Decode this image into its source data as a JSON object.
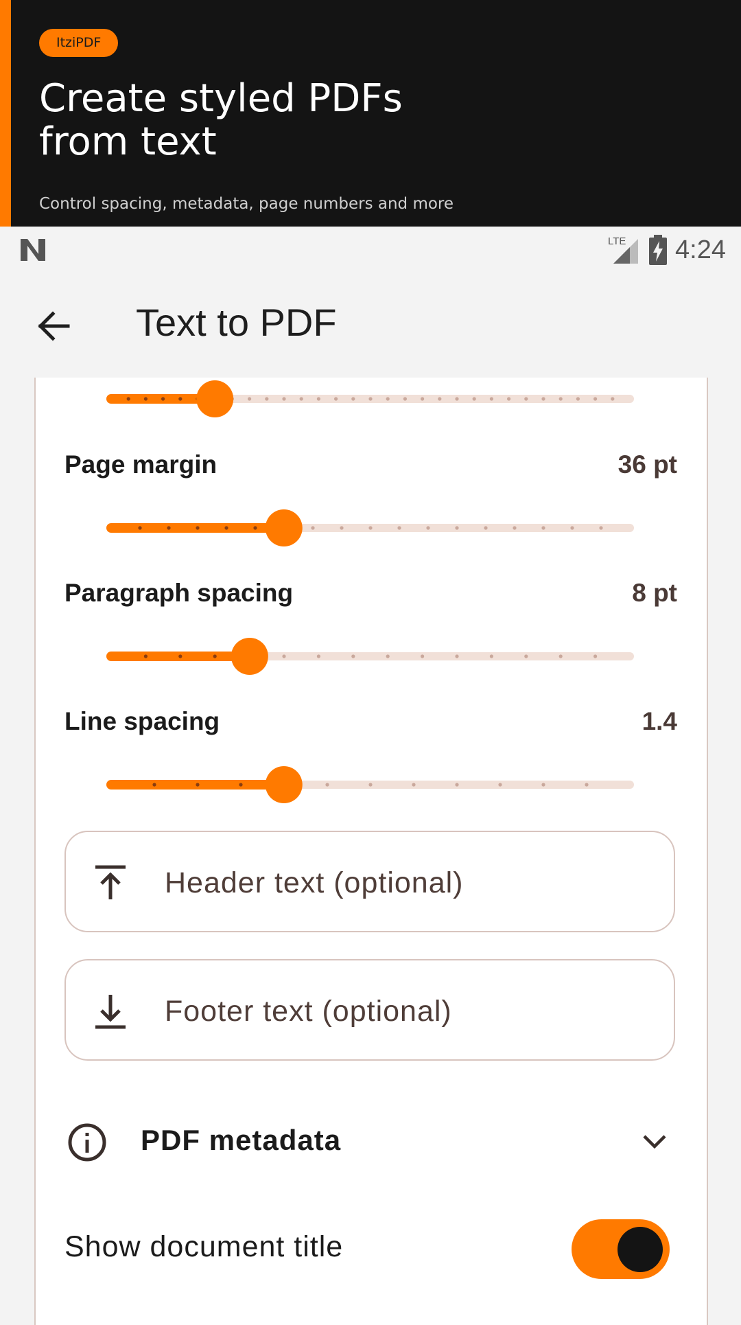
{
  "banner": {
    "badge": "ItziPDF",
    "title_line1": "Create styled PDFs",
    "title_line2": "from text",
    "subtitle": "Control spacing, metadata, page numbers and more"
  },
  "status": {
    "time": "4:24",
    "network": "LTE"
  },
  "appbar": {
    "title": "Text to PDF"
  },
  "settings": {
    "top_slider": {
      "fraction": 0.2,
      "ticks": 30
    },
    "page_margin": {
      "label": "Page margin",
      "value": "36 pt",
      "fraction": 0.333,
      "ticks": 18
    },
    "paragraph_spacing": {
      "label": "Paragraph spacing",
      "value": "8 pt",
      "fraction": 0.267,
      "ticks": 15
    },
    "line_spacing": {
      "label": "Line spacing",
      "value": "1.4",
      "fraction": 0.333,
      "ticks": 12
    }
  },
  "header_field": {
    "placeholder": "Header text (optional)",
    "value": ""
  },
  "footer_field": {
    "placeholder": "Footer text (optional)",
    "value": ""
  },
  "metadata": {
    "title": "PDF metadata"
  },
  "show_title": {
    "label": "Show document title",
    "on": true
  },
  "colors": {
    "accent": "#ff7a00",
    "inactive_track": "#f1e0d8",
    "banner_bg": "#141414"
  }
}
